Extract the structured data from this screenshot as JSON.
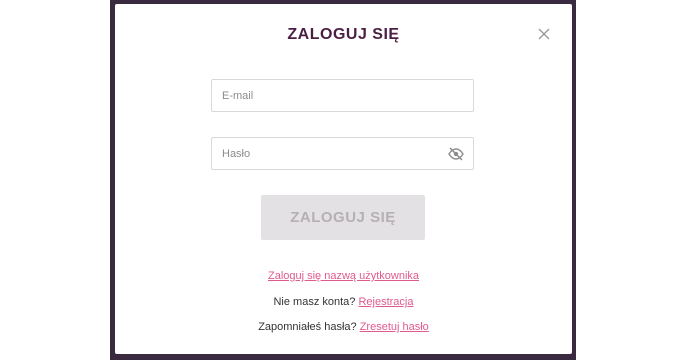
{
  "modal": {
    "title": "ZALOGUJ SIĘ",
    "close_icon": "close-icon"
  },
  "form": {
    "email_placeholder": "E-mail",
    "email_value": "",
    "password_placeholder": "Hasło",
    "password_value": "",
    "password_toggle_icon": "eye-slash-icon",
    "submit_label": "ZALOGUJ SIĘ",
    "submit_enabled": false
  },
  "links": {
    "username_login": "Zaloguj się nazwą użytkownika",
    "register_prompt": "Nie masz konta?",
    "register_link": "Rejestracja",
    "reset_prompt": "Zapomniałeś hasła?",
    "reset_link": "Zresetuj hasło"
  },
  "colors": {
    "title": "#4a1f43",
    "link": "#e05a8e",
    "submit_bg": "#e3e1e3",
    "submit_text": "#b5b0b5",
    "overlay": "#3a2a3f"
  }
}
